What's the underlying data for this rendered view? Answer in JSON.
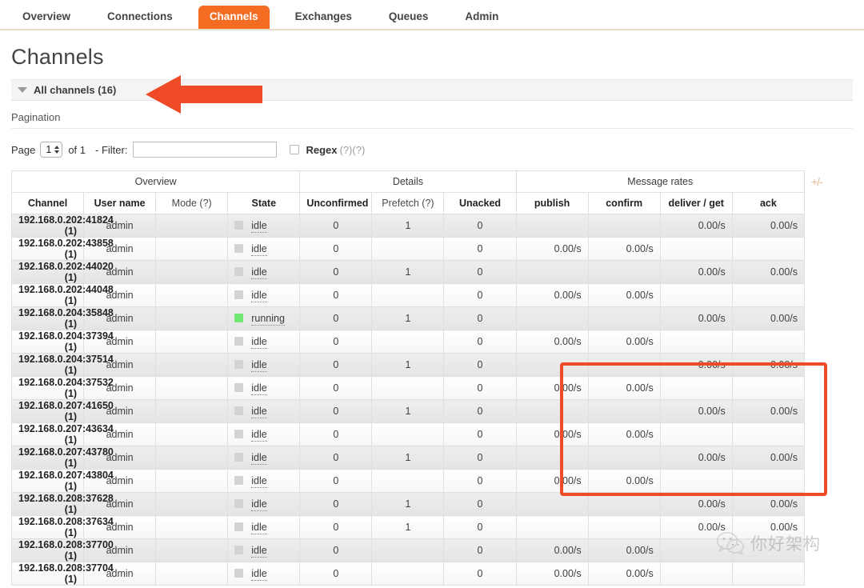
{
  "nav": {
    "tabs": [
      {
        "label": "Overview",
        "active": false
      },
      {
        "label": "Connections",
        "active": false
      },
      {
        "label": "Channels",
        "active": true
      },
      {
        "label": "Exchanges",
        "active": false
      },
      {
        "label": "Queues",
        "active": false
      },
      {
        "label": "Admin",
        "active": false
      }
    ],
    "active_color": "#f36c21"
  },
  "page": {
    "title": "Channels",
    "section_label": "All channels (16)"
  },
  "pagination": {
    "heading": "Pagination",
    "page_label": "Page",
    "page_value": "1",
    "of_label": "of 1",
    "filter_label": "- Filter:",
    "filter_value": "",
    "filter_placeholder": "",
    "regex_label": "Regex",
    "regex_help": "(?)(?)",
    "regex_checked": false
  },
  "table": {
    "plus_minus": "+/-",
    "groups": [
      {
        "label": "Overview",
        "span": 4
      },
      {
        "label": "Details",
        "span": 3
      },
      {
        "label": "Message rates",
        "span": 4
      }
    ],
    "columns": [
      {
        "label": "Channel",
        "bold": true
      },
      {
        "label": "User name",
        "bold": true
      },
      {
        "label": "Mode (?)",
        "bold": false
      },
      {
        "label": "State",
        "bold": true
      },
      {
        "label": "Unconfirmed",
        "bold": true
      },
      {
        "label": "Prefetch (?)",
        "bold": false
      },
      {
        "label": "Unacked",
        "bold": true
      },
      {
        "label": "publish",
        "bold": true
      },
      {
        "label": "confirm",
        "bold": true
      },
      {
        "label": "deliver / get",
        "bold": true
      },
      {
        "label": "ack",
        "bold": true
      }
    ],
    "rows": [
      {
        "channel": "192.168.0.202:41824 (1)",
        "user": "admin",
        "mode": "",
        "state": "idle",
        "state_color": "gray",
        "unconfirmed": "0",
        "prefetch": "1",
        "unacked": "0",
        "publish": "",
        "confirm": "",
        "deliver_get": "0.00/s",
        "ack": "0.00/s"
      },
      {
        "channel": "192.168.0.202:43858 (1)",
        "user": "admin",
        "mode": "",
        "state": "idle",
        "state_color": "gray",
        "unconfirmed": "0",
        "prefetch": "",
        "unacked": "0",
        "publish": "0.00/s",
        "confirm": "0.00/s",
        "deliver_get": "",
        "ack": ""
      },
      {
        "channel": "192.168.0.202:44020 (1)",
        "user": "admin",
        "mode": "",
        "state": "idle",
        "state_color": "gray",
        "unconfirmed": "0",
        "prefetch": "1",
        "unacked": "0",
        "publish": "",
        "confirm": "",
        "deliver_get": "0.00/s",
        "ack": "0.00/s"
      },
      {
        "channel": "192.168.0.202:44048 (1)",
        "user": "admin",
        "mode": "",
        "state": "idle",
        "state_color": "gray",
        "unconfirmed": "0",
        "prefetch": "",
        "unacked": "0",
        "publish": "0.00/s",
        "confirm": "0.00/s",
        "deliver_get": "",
        "ack": ""
      },
      {
        "channel": "192.168.0.204:35848 (1)",
        "user": "admin",
        "mode": "",
        "state": "running",
        "state_color": "green",
        "unconfirmed": "0",
        "prefetch": "1",
        "unacked": "0",
        "publish": "",
        "confirm": "",
        "deliver_get": "0.00/s",
        "ack": "0.00/s"
      },
      {
        "channel": "192.168.0.204:37394 (1)",
        "user": "admin",
        "mode": "",
        "state": "idle",
        "state_color": "gray",
        "unconfirmed": "0",
        "prefetch": "",
        "unacked": "0",
        "publish": "0.00/s",
        "confirm": "0.00/s",
        "deliver_get": "",
        "ack": ""
      },
      {
        "channel": "192.168.0.204:37514 (1)",
        "user": "admin",
        "mode": "",
        "state": "idle",
        "state_color": "gray",
        "unconfirmed": "0",
        "prefetch": "1",
        "unacked": "0",
        "publish": "",
        "confirm": "",
        "deliver_get": "0.00/s",
        "ack": "0.00/s"
      },
      {
        "channel": "192.168.0.204:37532 (1)",
        "user": "admin",
        "mode": "",
        "state": "idle",
        "state_color": "gray",
        "unconfirmed": "0",
        "prefetch": "",
        "unacked": "0",
        "publish": "0.00/s",
        "confirm": "0.00/s",
        "deliver_get": "",
        "ack": ""
      },
      {
        "channel": "192.168.0.207:41650 (1)",
        "user": "admin",
        "mode": "",
        "state": "idle",
        "state_color": "gray",
        "unconfirmed": "0",
        "prefetch": "1",
        "unacked": "0",
        "publish": "",
        "confirm": "",
        "deliver_get": "0.00/s",
        "ack": "0.00/s"
      },
      {
        "channel": "192.168.0.207:43634 (1)",
        "user": "admin",
        "mode": "",
        "state": "idle",
        "state_color": "gray",
        "unconfirmed": "0",
        "prefetch": "",
        "unacked": "0",
        "publish": "0.00/s",
        "confirm": "0.00/s",
        "deliver_get": "",
        "ack": ""
      },
      {
        "channel": "192.168.0.207:43780 (1)",
        "user": "admin",
        "mode": "",
        "state": "idle",
        "state_color": "gray",
        "unconfirmed": "0",
        "prefetch": "1",
        "unacked": "0",
        "publish": "",
        "confirm": "",
        "deliver_get": "0.00/s",
        "ack": "0.00/s"
      },
      {
        "channel": "192.168.0.207:43804 (1)",
        "user": "admin",
        "mode": "",
        "state": "idle",
        "state_color": "gray",
        "unconfirmed": "0",
        "prefetch": "",
        "unacked": "0",
        "publish": "0.00/s",
        "confirm": "0.00/s",
        "deliver_get": "",
        "ack": ""
      },
      {
        "channel": "192.168.0.208:37628 (1)",
        "user": "admin",
        "mode": "",
        "state": "idle",
        "state_color": "gray",
        "unconfirmed": "0",
        "prefetch": "1",
        "unacked": "0",
        "publish": "",
        "confirm": "",
        "deliver_get": "0.00/s",
        "ack": "0.00/s"
      },
      {
        "channel": "192.168.0.208:37634 (1)",
        "user": "admin",
        "mode": "",
        "state": "idle",
        "state_color": "gray",
        "unconfirmed": "0",
        "prefetch": "1",
        "unacked": "0",
        "publish": "",
        "confirm": "",
        "deliver_get": "0.00/s",
        "ack": "0.00/s"
      },
      {
        "channel": "192.168.0.208:37700 (1)",
        "user": "admin",
        "mode": "",
        "state": "idle",
        "state_color": "gray",
        "unconfirmed": "0",
        "prefetch": "",
        "unacked": "0",
        "publish": "0.00/s",
        "confirm": "0.00/s",
        "deliver_get": "",
        "ack": ""
      },
      {
        "channel": "192.168.0.208:37704 (1)",
        "user": "admin",
        "mode": "",
        "state": "idle",
        "state_color": "gray",
        "unconfirmed": "0",
        "prefetch": "",
        "unacked": "0",
        "publish": "0.00/s",
        "confirm": "0.00/s",
        "deliver_get": "",
        "ack": ""
      }
    ]
  },
  "annotations": {
    "highlight_color": "#ef4b28",
    "arrow_target": "All channels (16)",
    "rect_target": "Message rates"
  },
  "watermark": {
    "text": "你好架构"
  }
}
